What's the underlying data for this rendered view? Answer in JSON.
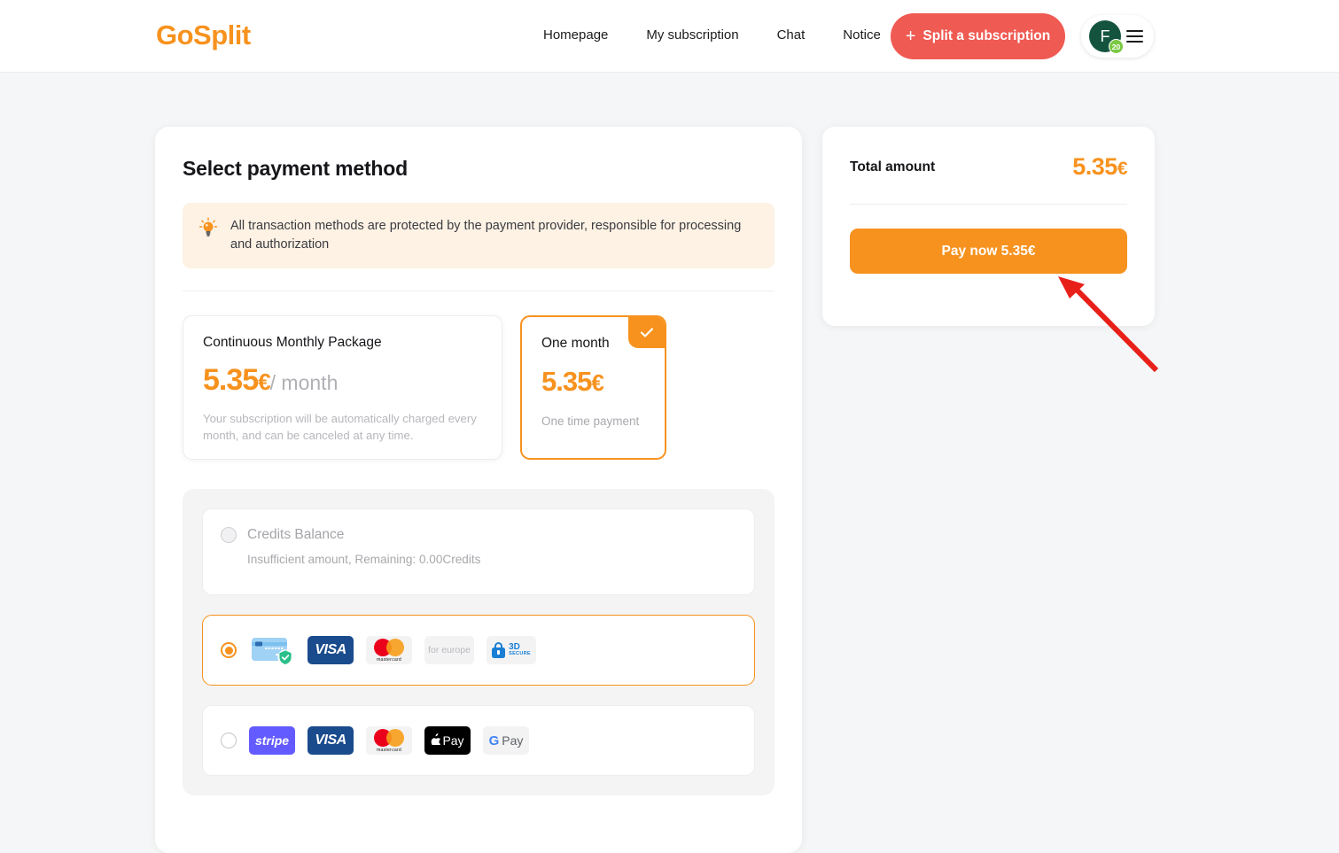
{
  "header": {
    "logo": "GoSplit",
    "nav": [
      {
        "label": "Homepage"
      },
      {
        "label": "My subscription"
      },
      {
        "label": "Chat"
      },
      {
        "label": "Notice"
      }
    ],
    "split_button": {
      "plus": "+",
      "label": "Split a subscription"
    },
    "avatar": {
      "initial": "F",
      "badge": "20"
    }
  },
  "main": {
    "title": "Select payment method",
    "info_banner": {
      "icon": "lightbulb-icon",
      "text": "All transaction methods are protected by the payment provider, responsible for processing and authorization"
    },
    "plans": [
      {
        "name": "Continuous Monthly Package",
        "price": "5.35",
        "currency": "€",
        "period": "/ month",
        "note": "Your subscription will be automatically charged every month, and can be canceled at any time.",
        "selected": false
      },
      {
        "name": "One month",
        "price": "5.35",
        "currency": "€",
        "note": "One time payment",
        "selected": true
      }
    ],
    "payment_methods": [
      {
        "id": "credits",
        "label": "Credits Balance",
        "sub": "Insufficient amount, Remaining: 0.00Credits",
        "state": "disabled",
        "selected": false
      },
      {
        "id": "card",
        "selected": true,
        "brands": [
          "credit-card-secure",
          "VISA",
          "mastercard",
          "for europe",
          "3D SECURE"
        ]
      },
      {
        "id": "stripe",
        "selected": false,
        "brands": [
          "stripe",
          "VISA",
          "mastercard",
          "Apple Pay",
          "G Pay"
        ]
      }
    ],
    "brand_text": {
      "visa": "VISA",
      "mastercard": "mastercard",
      "for_europe": "for europe",
      "threeds_line1": "3D",
      "threeds_line2": "SECURE",
      "stripe": "stripe",
      "apple_pay": "Pay",
      "gpay_g": "G",
      "gpay_pay": "Pay"
    }
  },
  "summary": {
    "total_label": "Total amount",
    "total_amount": "5.35",
    "currency": "€",
    "pay_button": "Pay now 5.35€"
  },
  "colors": {
    "orange": "#f7921e",
    "coral": "#ef5a52",
    "avatar_green": "#14543f",
    "badge_green": "#7ac943",
    "arrow_red": "#e8201a",
    "page_bg": "#f5f6f7"
  }
}
